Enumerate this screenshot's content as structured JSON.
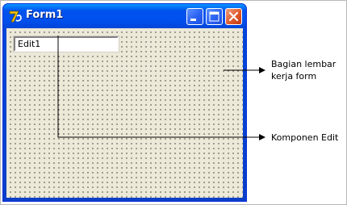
{
  "window": {
    "title": "Form1",
    "edit_text": "Edit1"
  },
  "annotations": {
    "form_area_line1": "Bagian lembar",
    "form_area_line2": "kerja form",
    "edit_component": "Komponen Edit"
  },
  "icons": {
    "app": "delphi-app-icon",
    "minimize": "minimize-icon",
    "maximize": "maximize-icon",
    "close": "close-icon"
  },
  "colors": {
    "titlebar": "#0053ee",
    "close_button": "#e05a2d",
    "form_background": "#ece9d8"
  }
}
